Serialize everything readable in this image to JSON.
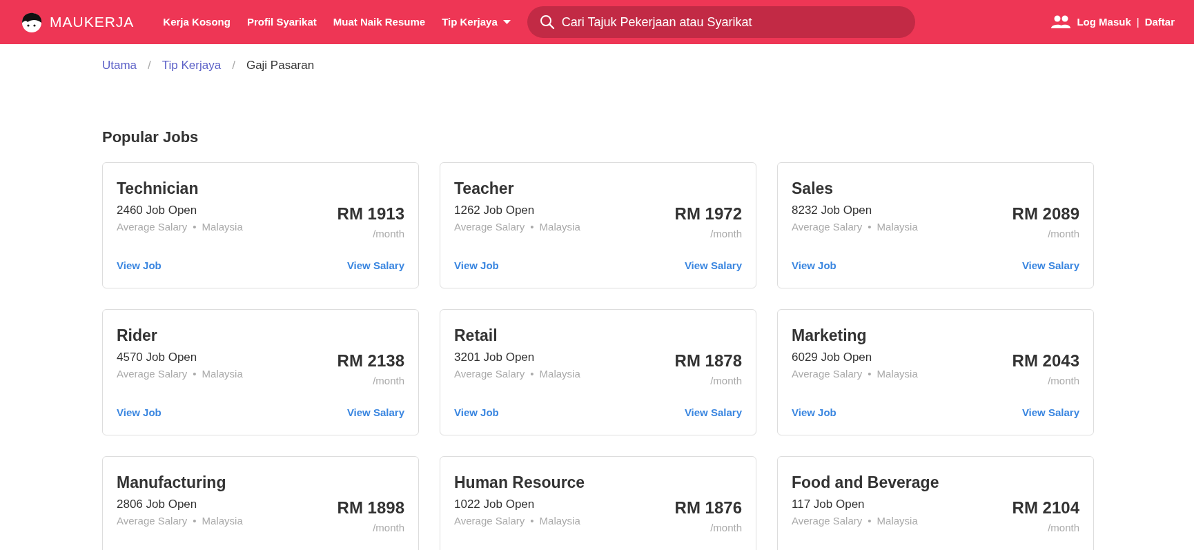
{
  "navbar": {
    "brand": "MAUKERJA",
    "links": [
      {
        "label": "Kerja Kosong",
        "kind": "link"
      },
      {
        "label": "Profil Syarikat",
        "kind": "link"
      },
      {
        "label": "Muat Naik Resume",
        "kind": "link"
      },
      {
        "label": "Tip Kerjaya",
        "kind": "dropdown"
      }
    ],
    "search": {
      "placeholder": "Cari Tajuk Pekerjaan atau Syarikat"
    },
    "login": "Log Masuk",
    "divider": "|",
    "register": "Daftar"
  },
  "breadcrumb": [
    {
      "label": "Utama",
      "active": false
    },
    {
      "separator": "/",
      "label": "Tip Kerjaya",
      "active": false
    },
    {
      "separator": "/",
      "label": "Gaji Pasaran",
      "active": true
    }
  ],
  "section_title": "Popular Jobs",
  "jobs": [
    {
      "title": "Technician",
      "openings": "2460 Job Open",
      "salary_label": "Average Salary",
      "separator": "•",
      "location": "Malaysia",
      "salary": "RM 1913",
      "period": "/month",
      "view_job": "View Job",
      "view_salary": "View Salary"
    },
    {
      "title": "Teacher",
      "openings": "1262 Job Open",
      "salary_label": "Average Salary",
      "separator": "•",
      "location": "Malaysia",
      "salary": "RM 1972",
      "period": "/month",
      "view_job": "View Job",
      "view_salary": "View Salary"
    },
    {
      "title": "Sales",
      "openings": "8232 Job Open",
      "salary_label": "Average Salary",
      "separator": "•",
      "location": "Malaysia",
      "salary": "RM 2089",
      "period": "/month",
      "view_job": "View Job",
      "view_salary": "View Salary"
    },
    {
      "title": "Rider",
      "openings": "4570 Job Open",
      "salary_label": "Average Salary",
      "separator": "•",
      "location": "Malaysia",
      "salary": "RM 2138",
      "period": "/month",
      "view_job": "View Job",
      "view_salary": "View Salary"
    },
    {
      "title": "Retail",
      "openings": "3201 Job Open",
      "salary_label": "Average Salary",
      "separator": "•",
      "location": "Malaysia",
      "salary": "RM 1878",
      "period": "/month",
      "view_job": "View Job",
      "view_salary": "View Salary"
    },
    {
      "title": "Marketing",
      "openings": "6029 Job Open",
      "salary_label": "Average Salary",
      "separator": "•",
      "location": "Malaysia",
      "salary": "RM 2043",
      "period": "/month",
      "view_job": "View Job",
      "view_salary": "View Salary"
    },
    {
      "title": "Manufacturing",
      "openings": "2806 Job Open",
      "salary_label": "Average Salary",
      "separator": "•",
      "location": "Malaysia",
      "salary": "RM 1898",
      "period": "/month"
    },
    {
      "title": "Human Resource",
      "openings": "1022 Job Open",
      "salary_label": "Average Salary",
      "separator": "•",
      "location": "Malaysia",
      "salary": "RM 1876",
      "period": "/month"
    },
    {
      "title": "Food and Beverage",
      "openings": "117 Job Open",
      "salary_label": "Average Salary",
      "separator": "•",
      "location": "Malaysia",
      "salary": "RM 2104",
      "period": "/month"
    }
  ]
}
